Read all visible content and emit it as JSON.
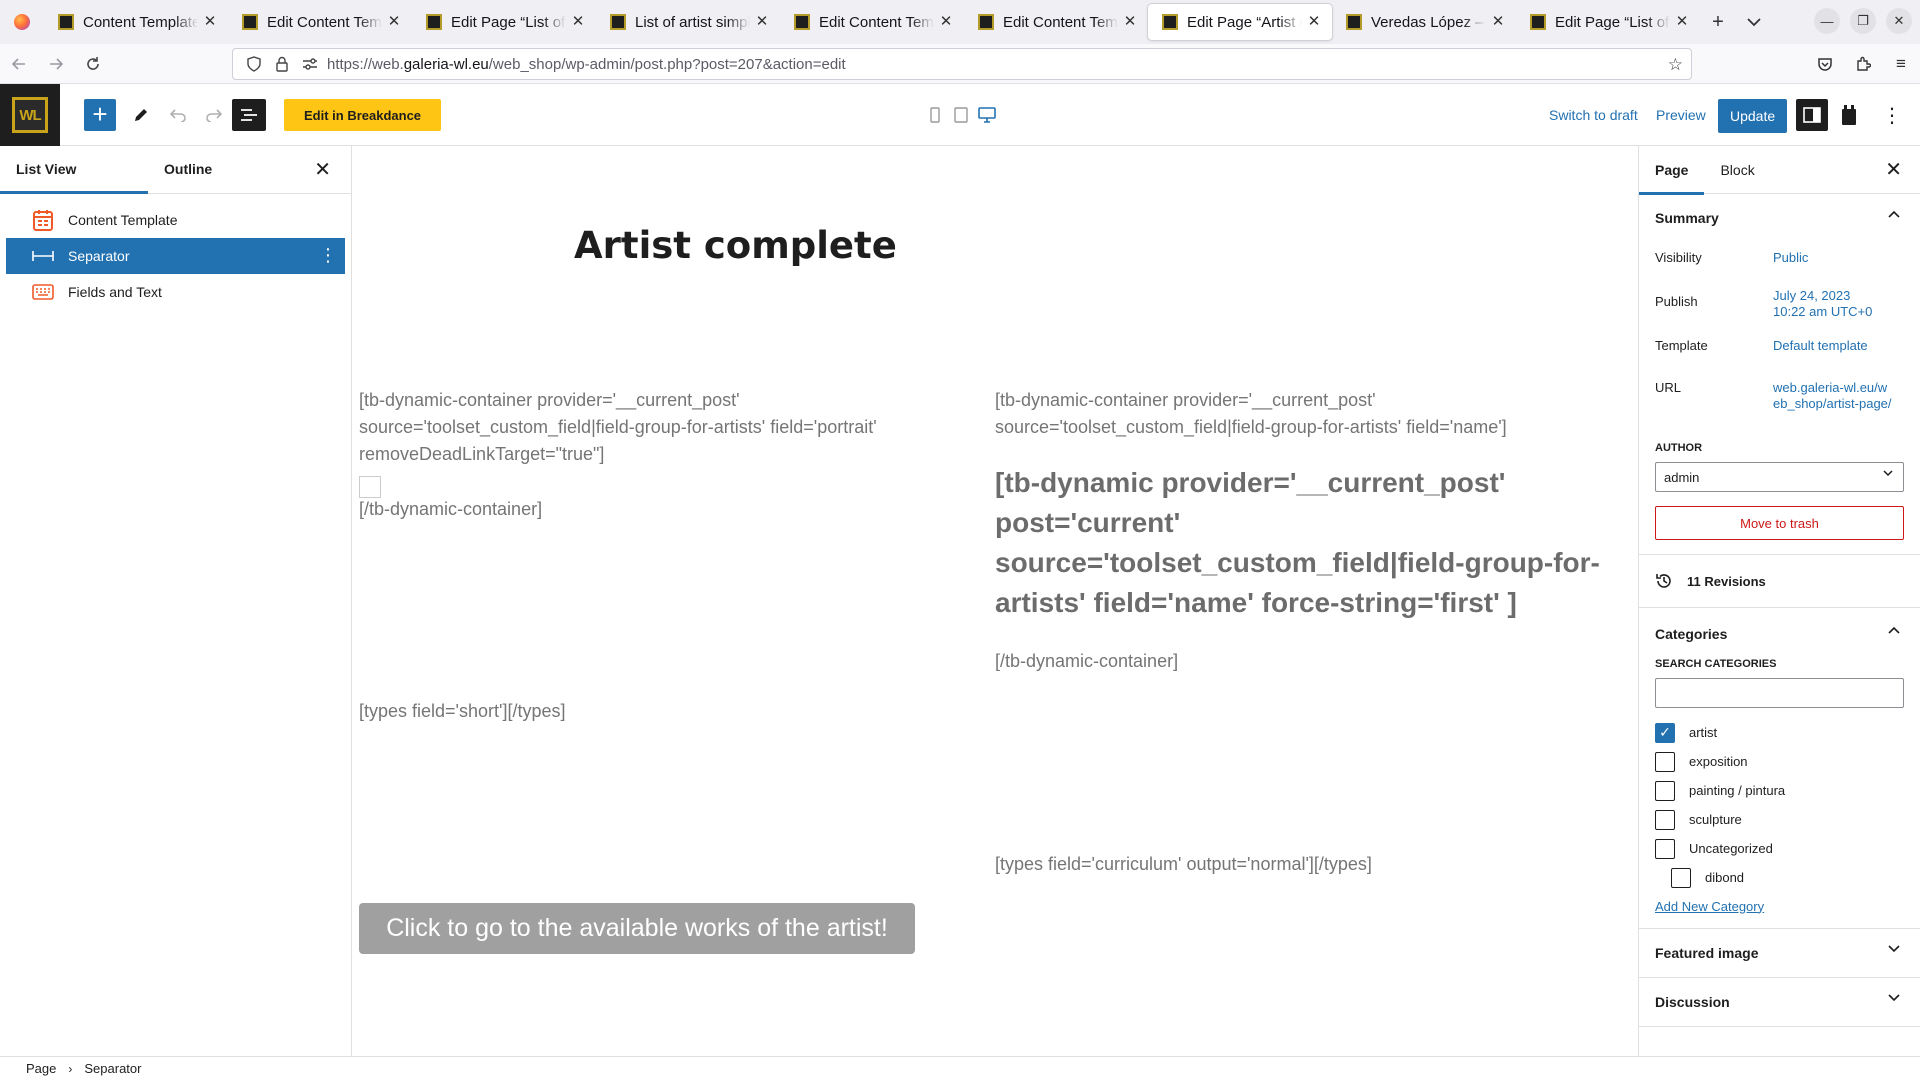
{
  "browser": {
    "tabs": [
      {
        "label": "Content Templates"
      },
      {
        "label": "Edit Content Template"
      },
      {
        "label": "Edit Page “List of artists”"
      },
      {
        "label": "List of artist simple"
      },
      {
        "label": "Edit Content Template"
      },
      {
        "label": "Edit Content Template"
      },
      {
        "label": "Edit Page “Artist complete”"
      },
      {
        "label": "Veredas López – Galeria"
      },
      {
        "label": "Edit Page “List of Artists”"
      }
    ],
    "url_prefix": "https://web.",
    "url_host": "galeria-wl.eu",
    "url_path": "/web_shop/wp-admin/post.php?post=207&action=edit"
  },
  "header": {
    "logo_text": "WL",
    "breakdance_label": "Edit in Breakdance",
    "switch_to_draft": "Switch to draft",
    "preview": "Preview",
    "update": "Update"
  },
  "left_panel": {
    "tab_list_view": "List View",
    "tab_outline": "Outline",
    "blocks": [
      {
        "label": "Content Template",
        "icon": "content-template-icon"
      },
      {
        "label": "Separator",
        "icon": "separator-icon"
      },
      {
        "label": "Fields and Text",
        "icon": "keyboard-icon"
      }
    ]
  },
  "canvas": {
    "title": "Artist complete",
    "portrait_open": "[tb-dynamic-container provider='__current_post' source='toolset_custom_field|field-group-for-artists' field='portrait' removeDeadLinkTarget=\"true\"]",
    "portrait_close": "[/tb-dynamic-container]",
    "name_open": "[tb-dynamic-container provider='__current_post' source='toolset_custom_field|field-group-for-artists' field='name']",
    "name_dynamic": "[tb-dynamic provider='__current_post' post='current' source='toolset_custom_field|field-group-for-artists' field='name' force-string='first' ]",
    "name_close": "[/tb-dynamic-container]",
    "short": "[types field='short'][/types]",
    "curriculum": "[types field='curriculum' output='normal'][/types]",
    "cta": "Click to go to the available works of the artist!"
  },
  "right_panel": {
    "tab_page": "Page",
    "tab_block": "Block",
    "summary_label": "Summary",
    "visibility_label": "Visibility",
    "visibility_value": "Public",
    "publish_label": "Publish",
    "publish_line1": "July 24, 2023",
    "publish_line2": "10:22 am UTC+0",
    "template_label": "Template",
    "template_value": "Default template",
    "url_label": "URL",
    "url_value": "web.galeria-wl.eu/web_shop/artist-page/",
    "author_label": "AUTHOR",
    "author_value": "admin",
    "trash_label": "Move to trash",
    "revisions_label": "11 Revisions",
    "categories_label": "Categories",
    "search_categories_label": "SEARCH CATEGORIES",
    "categories": [
      {
        "label": "artist",
        "checked": true
      },
      {
        "label": "exposition",
        "checked": false
      },
      {
        "label": "painting / pintura",
        "checked": false
      },
      {
        "label": "sculpture",
        "checked": false
      },
      {
        "label": "Uncategorized",
        "checked": false
      },
      {
        "label": "dibond",
        "checked": false
      }
    ],
    "add_category_label": "Add New Category",
    "featured_image_label": "Featured image",
    "discussion_label": "Discussion"
  },
  "footer": {
    "crumb_page": "Page",
    "crumb_block": "Separator"
  },
  "colors": {
    "accent": "#2271b1",
    "breakdance": "#ffc514",
    "danger": "#cc1818"
  }
}
